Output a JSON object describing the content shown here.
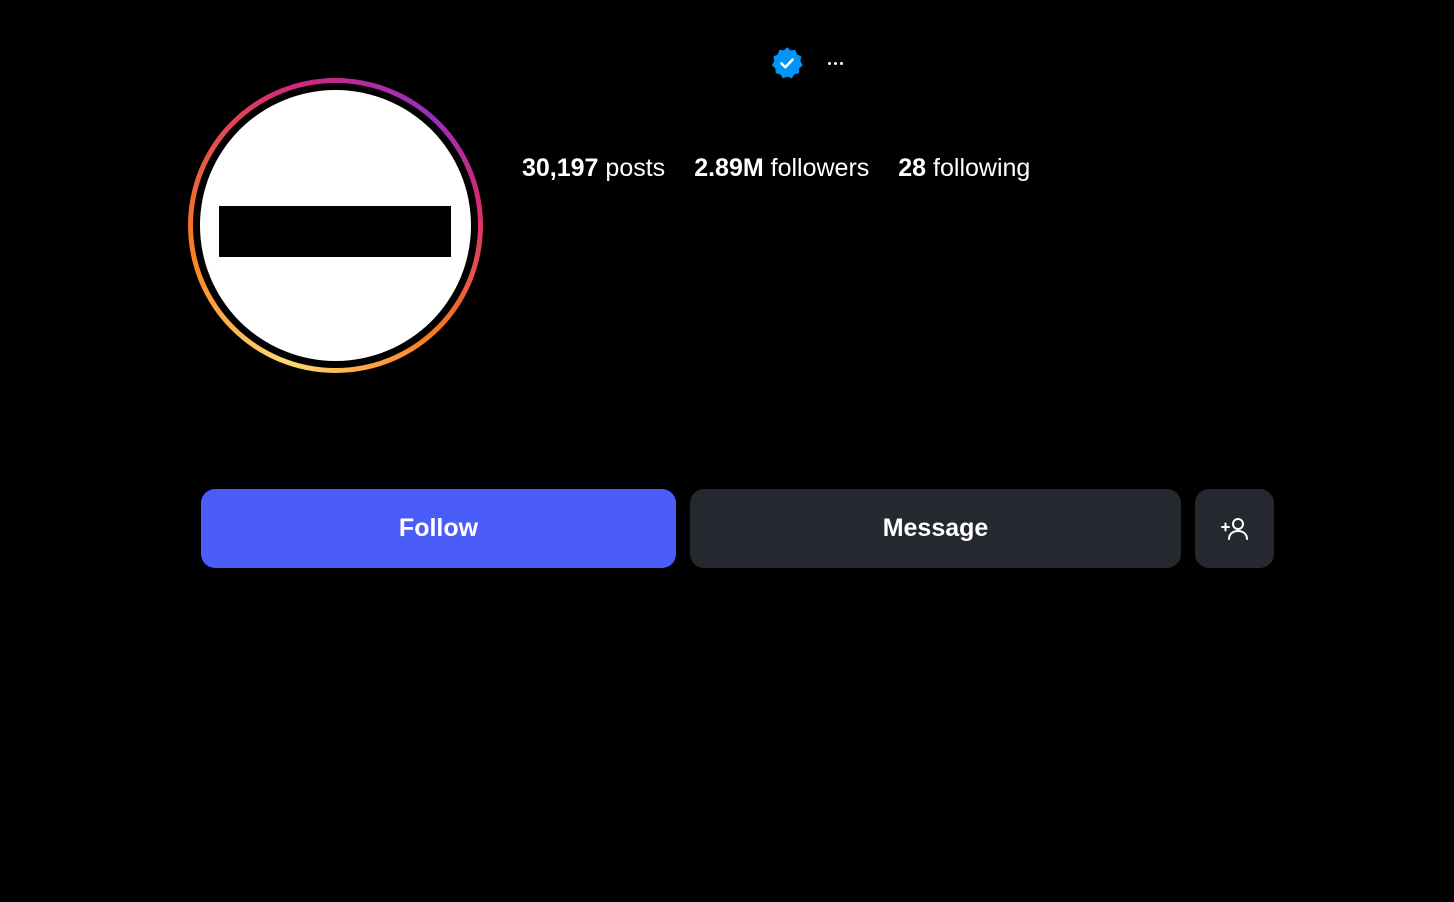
{
  "profile": {
    "verified": true,
    "more_icon": "more-horizontal-icon"
  },
  "stats": {
    "posts_count": "30,197",
    "posts_label": "posts",
    "followers_count": "2.89M",
    "followers_label": "followers",
    "following_count": "28",
    "following_label": "following"
  },
  "actions": {
    "follow_label": "Follow",
    "message_label": "Message",
    "suggest_icon": "add-person-icon"
  },
  "colors": {
    "background": "#000000",
    "follow_button": "#4a5df9",
    "secondary_button": "#25282e",
    "verified_badge": "#0095f6"
  }
}
